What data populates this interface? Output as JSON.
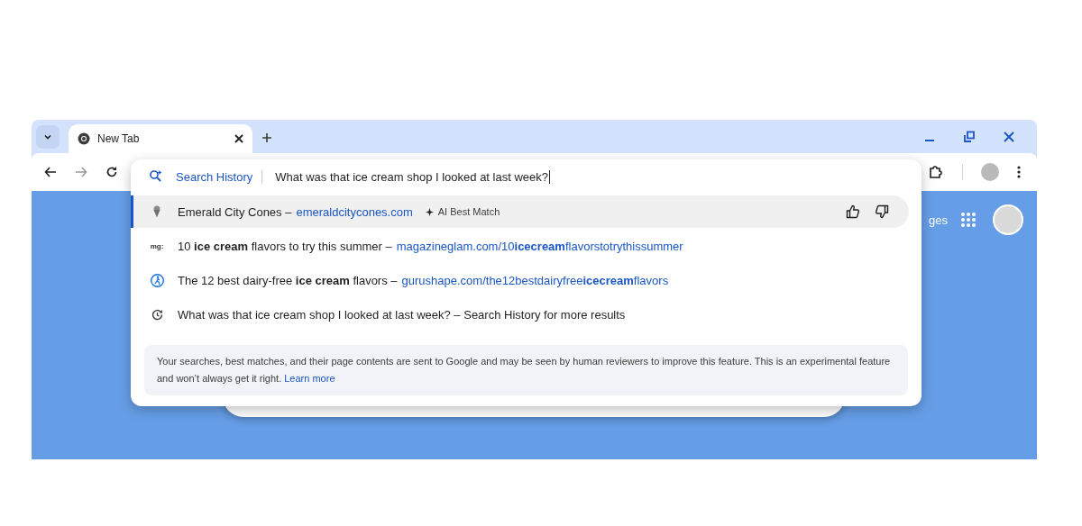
{
  "tabs": [
    {
      "title": "New Tab",
      "selected": true
    }
  ],
  "omnibox": {
    "chip": "Search History",
    "value": "What was that ice cream shop I looked at last week?"
  },
  "suggestions": [
    {
      "kind": "place",
      "selected": true,
      "title": "Emerald City Cones –",
      "url": "emeraldcitycones.com",
      "badge": "AI Best Match"
    },
    {
      "kind": "site",
      "selected": false,
      "favicon": "mg:",
      "title": "10 **ice cream** flavors to try this summer –",
      "url": "magazineglam.com/10**icecream**flavorstotrythissummer"
    },
    {
      "kind": "fitness",
      "selected": false,
      "title": "The 12 best dairy-free **ice cream** flavors –",
      "url": "gurushape.com/the12bestdairyfree**icecream**flavors"
    },
    {
      "kind": "history",
      "selected": false,
      "title": "What was that ice cream shop I looked at last week? – Search History for more results"
    }
  ],
  "disclaimer": {
    "text": "Your searches, best matches, and their page contents are sent to Google and may be seen by human reviewers to improve this feature. This is an experimental feature and won’t always get it right.",
    "link": "Learn more"
  },
  "page": {
    "images_link": "ges"
  }
}
